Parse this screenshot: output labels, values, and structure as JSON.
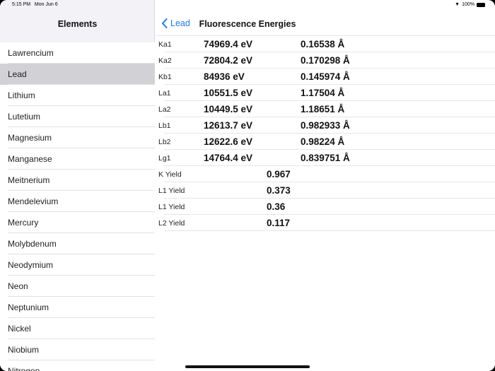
{
  "status": {
    "time": "5:15 PM",
    "date": "Mon Jun 6",
    "battery": "100%"
  },
  "sidebar": {
    "title": "Elements",
    "selected": "Lead",
    "items": [
      "Lawrencium",
      "Lead",
      "Lithium",
      "Lutetium",
      "Magnesium",
      "Manganese",
      "Meitnerium",
      "Mendelevium",
      "Mercury",
      "Molybdenum",
      "Neodymium",
      "Neon",
      "Neptunium",
      "Nickel",
      "Niobium",
      "Nitrogen"
    ]
  },
  "nav": {
    "back_label": "Lead",
    "title": "Fluorescence Energies"
  },
  "lines": [
    {
      "label": "Ka1",
      "energy": "74969.4 eV",
      "wavelength": "0.16538 Å"
    },
    {
      "label": "Ka2",
      "energy": "72804.2 eV",
      "wavelength": "0.170298 Å"
    },
    {
      "label": "Kb1",
      "energy": "84936 eV",
      "wavelength": "0.145974 Å"
    },
    {
      "label": "La1",
      "energy": "10551.5 eV",
      "wavelength": "1.17504 Å"
    },
    {
      "label": "La2",
      "energy": "10449.5 eV",
      "wavelength": "1.18651 Å"
    },
    {
      "label": "Lb1",
      "energy": "12613.7 eV",
      "wavelength": "0.982933 Å"
    },
    {
      "label": "Lb2",
      "energy": "12622.6 eV",
      "wavelength": "0.98224 Å"
    },
    {
      "label": "Lg1",
      "energy": "14764.4 eV",
      "wavelength": "0.839751 Å"
    }
  ],
  "yields": [
    {
      "label": "K Yield",
      "value": "0.967"
    },
    {
      "label": "L1 Yield",
      "value": "0.373"
    },
    {
      "label": "L1 Yield",
      "value": "0.36"
    },
    {
      "label": "L2 Yield",
      "value": "0.117"
    }
  ],
  "colors": {
    "accent": "#1a7cf5",
    "selected": "#d1d1d6"
  }
}
